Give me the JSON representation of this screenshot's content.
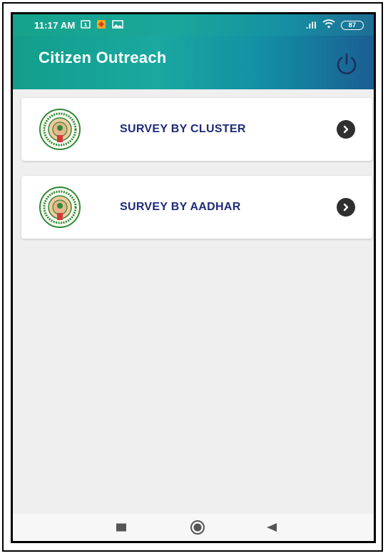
{
  "statusbar": {
    "time": "11:17 AM",
    "icons_left": [
      "sim-icon",
      "app-notification-icon",
      "image-icon"
    ],
    "signal": ".ıll",
    "battery": "87"
  },
  "header": {
    "title": "Citizen Outreach",
    "power_icon": "power-icon"
  },
  "menu": {
    "items": [
      {
        "label": "SURVEY BY CLUSTER",
        "icon": "state-emblem-icon",
        "action_icon": "chevron-right-icon"
      },
      {
        "label": "SURVEY BY AADHAR",
        "icon": "state-emblem-icon",
        "action_icon": "chevron-right-icon"
      }
    ]
  },
  "navbar": {
    "buttons": [
      "recents-button",
      "home-button",
      "back-button"
    ]
  },
  "colors": {
    "header_gradient_start": "#129e8a",
    "header_gradient_end": "#1a5e92",
    "label_color": "#1f2a7a",
    "background": "#efefef"
  }
}
